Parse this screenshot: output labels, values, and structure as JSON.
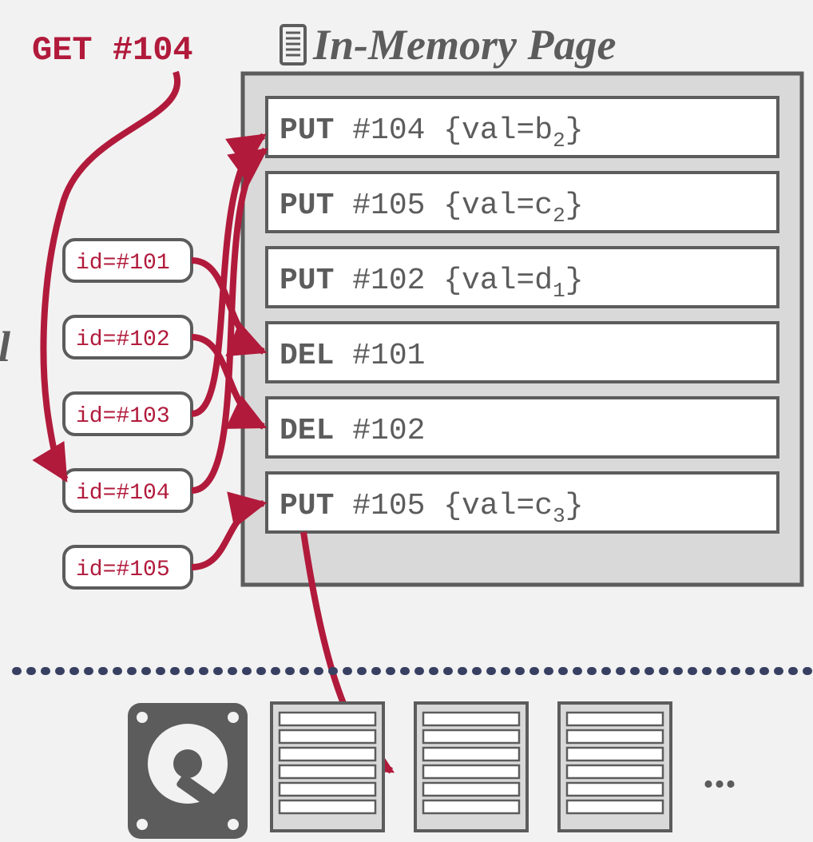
{
  "labels": {
    "get": "GET #104",
    "title": "In-Memory Page",
    "ellipsis": "..."
  },
  "ids": [
    {
      "label": "id=#101"
    },
    {
      "label": "id=#102"
    },
    {
      "label": "id=#103"
    },
    {
      "label": "id=#104"
    },
    {
      "label": "id=#105"
    }
  ],
  "ops": [
    {
      "op": "PUT",
      "rest": " #104 {val=b",
      "sub": "2",
      "tail": "}"
    },
    {
      "op": "PUT",
      "rest": " #105 {val=c",
      "sub": "2",
      "tail": "}"
    },
    {
      "op": "PUT",
      "rest": " #102 {val=d",
      "sub": "1",
      "tail": "}"
    },
    {
      "op": "DEL",
      "rest": " #101",
      "sub": "",
      "tail": ""
    },
    {
      "op": "DEL",
      "rest": " #102",
      "sub": "",
      "tail": ""
    },
    {
      "op": "PUT",
      "rest": " #105 {val=c",
      "sub": "3",
      "tail": "}"
    }
  ]
}
